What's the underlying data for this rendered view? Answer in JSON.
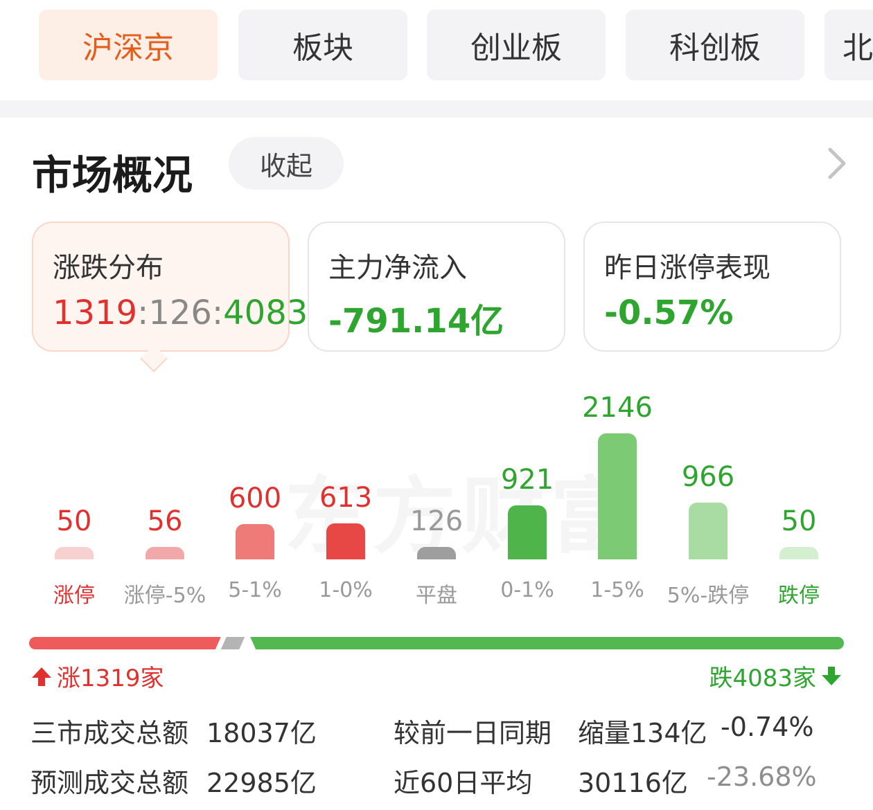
{
  "tabs": [
    {
      "label": "沪深京",
      "active": true
    },
    {
      "label": "板块",
      "active": false
    },
    {
      "label": "创业板",
      "active": false
    },
    {
      "label": "科创板",
      "active": false
    },
    {
      "label": "北",
      "active": false
    }
  ],
  "overview": {
    "title": "市场概况",
    "collapse_label": "收起",
    "chevron_icon": "chevron-right-icon"
  },
  "stats": {
    "distribution": {
      "label": "涨跌分布",
      "up": "1319",
      "sep1": ":",
      "flat": "126",
      "sep2": ":",
      "down": "4083"
    },
    "main_flow": {
      "label": "主力净流入",
      "value": "-791.14亿"
    },
    "yesterday_limit": {
      "label": "昨日涨停表现",
      "value": "-0.57%"
    }
  },
  "watermark": "东方财富",
  "chart_data": {
    "type": "bar",
    "categories": [
      "涨停",
      "涨停-5%",
      "5-1%",
      "1-0%",
      "平盘",
      "0-1%",
      "1-5%",
      "5%-跌停",
      "跌停"
    ],
    "values": [
      50,
      56,
      600,
      613,
      126,
      921,
      2146,
      966,
      50
    ],
    "labels": [
      "50",
      "56",
      "600",
      "613",
      "126",
      "921",
      "2146",
      "966",
      "50"
    ],
    "bar_colors": [
      "#f7d0d0",
      "#f2a8a8",
      "#ee7b78",
      "#e84845",
      "#9e9e9e",
      "#4fb54a",
      "#7ccb74",
      "#a9dca2",
      "#d3efcf"
    ],
    "value_colors": [
      "#e0312f",
      "#e0312f",
      "#e0312f",
      "#e0312f",
      "#999999",
      "#2ea52e",
      "#2ea52e",
      "#2ea52e",
      "#2ea52e"
    ],
    "category_colors": [
      "#e0312f",
      "#999999",
      "#999999",
      "#999999",
      "#999999",
      "#999999",
      "#999999",
      "#999999",
      "#2ea52e"
    ]
  },
  "ratio": {
    "up": 1319,
    "flat": 126,
    "down": 4083,
    "up_color": "#ef5b5b",
    "flat_color": "#b4b4b4",
    "down_color": "#52b84f",
    "up_label": "涨1319家",
    "down_label": "跌4083家",
    "up_icon": "arrow-up-icon",
    "down_icon": "arrow-down-icon"
  },
  "turnover": {
    "row1": {
      "label": "三市成交总额",
      "value": "18037亿",
      "cmp_label": "较前一日同期",
      "change": "缩量134亿",
      "pct": "-0.74%"
    },
    "row2": {
      "label": "预测成交总额",
      "value": "22985亿",
      "cmp_label": "近60日平均",
      "avg": "30116亿",
      "pct": "-23.68%"
    }
  }
}
